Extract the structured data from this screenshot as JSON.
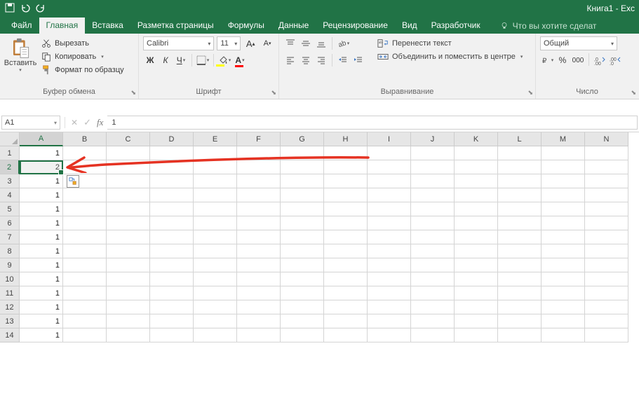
{
  "title": "Книга1 - Exc",
  "tabs": {
    "file": "Файл",
    "home": "Главная",
    "insert": "Вставка",
    "page_layout": "Разметка страницы",
    "formulas": "Формулы",
    "data": "Данные",
    "review": "Рецензирование",
    "view": "Вид",
    "developer": "Разработчик"
  },
  "tell_me": "Что вы хотите сделат",
  "clipboard": {
    "paste": "Вставить",
    "cut": "Вырезать",
    "copy": "Копировать",
    "format_painter": "Формат по образцу",
    "group": "Буфер обмена"
  },
  "font": {
    "name": "Calibri",
    "size": "11",
    "group": "Шрифт"
  },
  "alignment": {
    "wrap": "Перенести текст",
    "merge": "Объединить и поместить в центре",
    "group": "Выравнивание"
  },
  "number": {
    "format": "Общий",
    "group": "Число"
  },
  "namebox": "A1",
  "formula": "1",
  "columns": [
    "A",
    "B",
    "C",
    "D",
    "E",
    "F",
    "G",
    "H",
    "I",
    "J",
    "K",
    "L",
    "M",
    "N"
  ],
  "rows": [
    1,
    2,
    3,
    4,
    5,
    6,
    7,
    8,
    9,
    10,
    11,
    12,
    13,
    14
  ],
  "selected_col_idx": 0,
  "selected_row_idx": 1,
  "colA": [
    "1",
    "2",
    "1",
    "1",
    "1",
    "1",
    "1",
    "1",
    "1",
    "1",
    "1",
    "1",
    "1",
    "1"
  ]
}
